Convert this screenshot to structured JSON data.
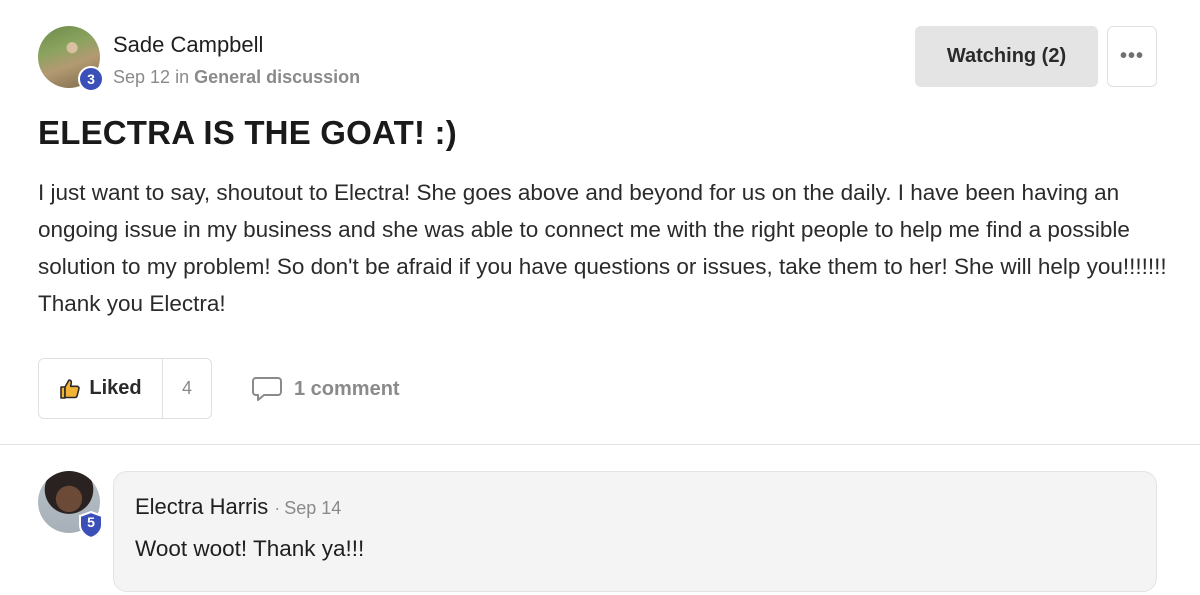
{
  "post": {
    "author": {
      "name": "Sade Campbell",
      "level": "3",
      "date": "Sep 12",
      "in_text": "in",
      "category": "General discussion"
    },
    "watching_label": "Watching (2)",
    "more_label": "•••",
    "title": "ELECTRA IS THE GOAT! :)",
    "body": "I just want to say, shoutout to Electra! She goes above and beyond for us on the daily. I have been having an ongoing issue in my business and she was able to connect me with the right people to help me find a possible solution to my problem! So don't be afraid if you have questions or issues, take them to her! She will help you!!!!!!! Thank you Electra!",
    "like_label": "Liked",
    "like_count": "4",
    "comment_count_label": "1 comment"
  },
  "comment": {
    "author": "Electra Harris",
    "level": "5",
    "separator": "·",
    "date": "Sep 14",
    "text": "Woot woot! Thank ya!!!"
  },
  "colors": {
    "badge_blue": "#3b4fb8",
    "watching_bg": "#e4e4e4",
    "comment_bg": "#f4f4f4",
    "muted_text": "#8a8a8a"
  },
  "icons": {
    "like": "thumbs-up-icon",
    "comment": "speech-bubble-icon",
    "more": "ellipsis-icon"
  }
}
